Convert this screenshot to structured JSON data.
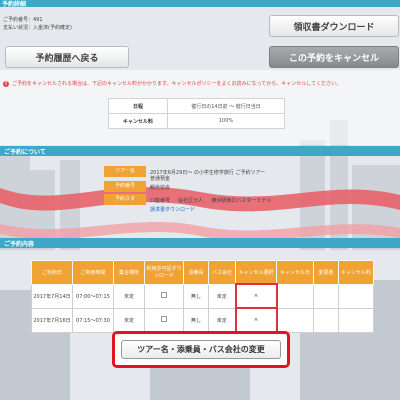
{
  "header": {
    "title": "予約詳細"
  },
  "booking_meta": {
    "number": "ご予約番号：491",
    "payment_status": "支払い状況：入金済(予約確定)"
  },
  "buttons": {
    "receipt_download": "領収書ダウンロード",
    "back_to_history": "予約履歴へ戻る",
    "cancel_booking": "この予約をキャンセル",
    "change_tour": "ツアー名・添乗員・バス会社の変更"
  },
  "warning": {
    "text": "ご予約をキャンセルされる場合は、下記のキャンセル料がかかります。キャンセルポリシーをよくお読みになってから、キャンセルしてください。"
  },
  "cancel_policy": {
    "rows": [
      {
        "label": "日程",
        "value": "催行日の14日前 〜 催行日当日"
      },
      {
        "label": "キャンセル料",
        "value": "100%"
      }
    ]
  },
  "sections": {
    "about": "ご予約について",
    "content": "ご予約内容"
  },
  "booking_info": {
    "rows": [
      {
        "label": "ツアー名",
        "value": "2017年6月29日〜 の小学生修学旅行 ご予約ツアー"
      },
      {
        "label": "予約番号",
        "value": "観光協会"
      },
      {
        "label": "予約スタ",
        "value": "口座番号 　 会社区分人 　 横浜駅西口バスターミナル"
      }
    ],
    "sub_value": "普通預金",
    "receipt_link": "請求書ダウンロード"
  },
  "booking_table": {
    "headers": [
      "ご利用日",
      "ご利用時間",
      "集合場所",
      "利用許可証ダウンロード",
      "添乗員",
      "バス会社",
      "キャンセル選択",
      "キャンセル日",
      "変更者",
      "キャンセル料"
    ],
    "rows": [
      {
        "date": "2017年7月14日",
        "time": "07:00〜07:15",
        "place": "未定",
        "guide": "無し",
        "bus": "未定",
        "cancel": "×"
      },
      {
        "date": "2017年7月16日",
        "time": "07:15〜07:30",
        "place": "未定",
        "guide": "無し",
        "bus": "未定",
        "cancel": "×"
      }
    ]
  },
  "colors": {
    "accent_blue": "#3fa8c9",
    "orange": "#f0a232",
    "warning_red": "#e04545",
    "highlight_red": "#e0151f"
  }
}
